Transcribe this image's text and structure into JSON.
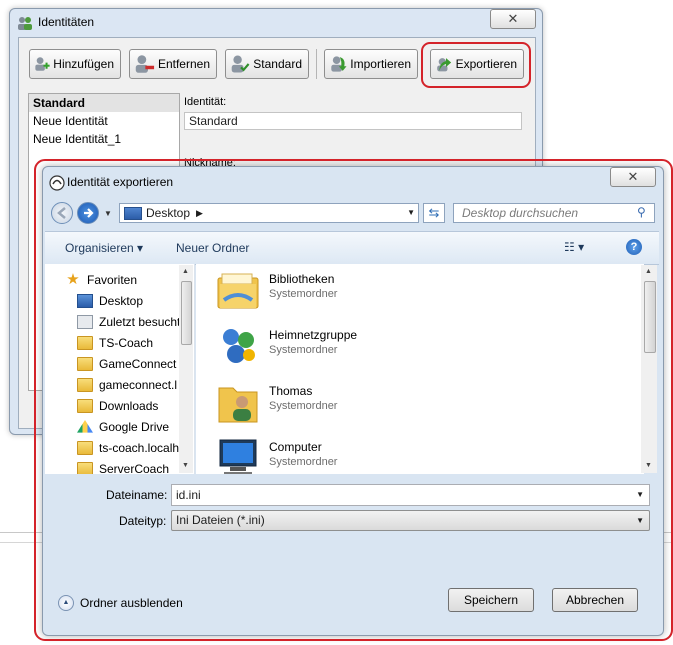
{
  "identities_window": {
    "title": "Identitäten",
    "close": "✕",
    "toolbar": {
      "add_label": "Hinzufügen",
      "remove_label": "Entfernen",
      "default_label": "Standard",
      "import_label": "Importieren",
      "export_label": "Exportieren"
    },
    "identity_list": [
      "Standard",
      "Neue Identität",
      "Neue Identität_1"
    ],
    "selected_identity": "Standard",
    "identity_label": "Identität:",
    "identity_value": "Standard",
    "nickname_label": "Nickname:"
  },
  "export_dialog": {
    "title": "Identität exportieren",
    "close": "✕",
    "address": "Desktop",
    "search_placeholder": "Desktop durchsuchen",
    "commands": {
      "organize": "Organisieren ▾",
      "new_folder": "Neuer Ordner",
      "view": "☷ ▾",
      "help": "?"
    },
    "nav_items": [
      {
        "label": "Favoriten",
        "icon": "star-icon"
      },
      {
        "label": "Desktop",
        "icon": "desktop-icon"
      },
      {
        "label": "Zuletzt besucht",
        "icon": "recent-places-icon"
      },
      {
        "label": "TS-Coach",
        "icon": "folder-icon"
      },
      {
        "label": "GameConnect",
        "icon": "folder-icon"
      },
      {
        "label": "gameconnect.l",
        "icon": "folder-icon"
      },
      {
        "label": "Downloads",
        "icon": "folder-icon"
      },
      {
        "label": "Google Drive",
        "icon": "google-drive-icon"
      },
      {
        "label": "ts-coach.localh",
        "icon": "folder-icon"
      },
      {
        "label": "ServerCoach",
        "icon": "folder-icon"
      }
    ],
    "files": [
      {
        "name": "Bibliotheken",
        "type": "Systemordner",
        "icon": "libraries-icon"
      },
      {
        "name": "Heimnetzgruppe",
        "type": "Systemordner",
        "icon": "homegroup-icon"
      },
      {
        "name": "Thomas",
        "type": "Systemordner",
        "icon": "user-folder-icon"
      },
      {
        "name": "Computer",
        "type": "Systemordner",
        "icon": "computer-icon"
      }
    ],
    "filename_label": "Dateiname:",
    "filename_value": "id.ini",
    "filetype_label": "Dateityp:",
    "filetype_value": "Ini Dateien (*.ini)",
    "hide_folders": "Ordner ausblenden",
    "save_label": "Speichern",
    "cancel_label": "Abbrechen"
  },
  "colors": {
    "highlight": "#d4232a",
    "window_frame": "#dbe6f3",
    "link_text": "#1e395b"
  }
}
